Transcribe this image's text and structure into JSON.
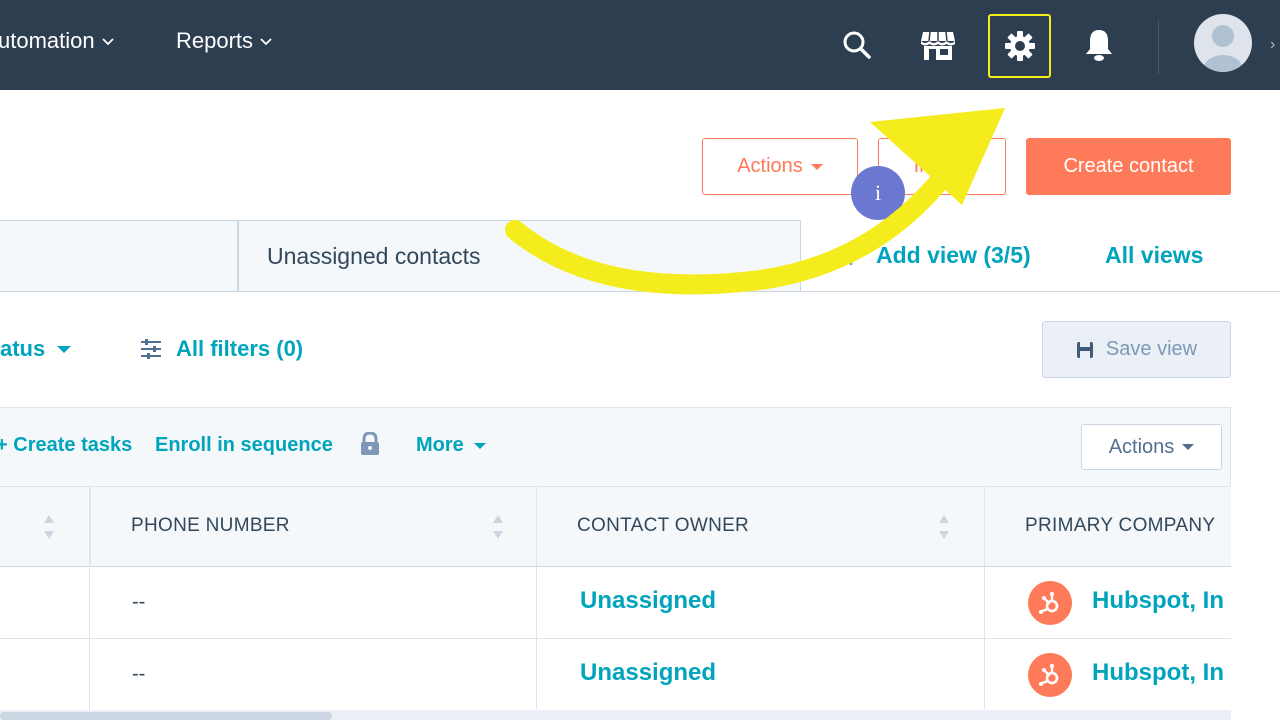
{
  "nav": {
    "automation_label": "utomation",
    "reports_label": "Reports",
    "icons": [
      "search-icon",
      "marketplace-icon",
      "settings-icon",
      "bell-icon"
    ]
  },
  "header": {
    "actions_label": "Actions",
    "import_label": "Im    rt",
    "create_contact_label": "Create contact",
    "info_badge": "i"
  },
  "tabs": {
    "unassigned_label": "Unassigned contacts",
    "add_view_label": "Add view (3/5)",
    "all_views_label": "All views"
  },
  "filters": {
    "status_label": "atus",
    "all_filters_label": "All filters (0)",
    "save_view_label": "Save view"
  },
  "bulk": {
    "create_tasks_label": "Create tasks",
    "enroll_label": "Enroll in sequence",
    "more_label": "More",
    "actions_label": "Actions"
  },
  "table": {
    "columns": [
      "PHONE NUMBER",
      "CONTACT OWNER",
      "PRIMARY COMPANY"
    ],
    "rows": [
      {
        "phone": "--",
        "owner": "Unassigned",
        "company": "Hubspot, In"
      },
      {
        "phone": "--",
        "owner": "Unassigned",
        "company": "Hubspot, In"
      }
    ]
  },
  "colors": {
    "nav_bg": "#2d3e50",
    "accent_orange": "#ff7a59",
    "link_teal": "#00a4bd",
    "highlight_yellow": "#f5ec1e"
  }
}
